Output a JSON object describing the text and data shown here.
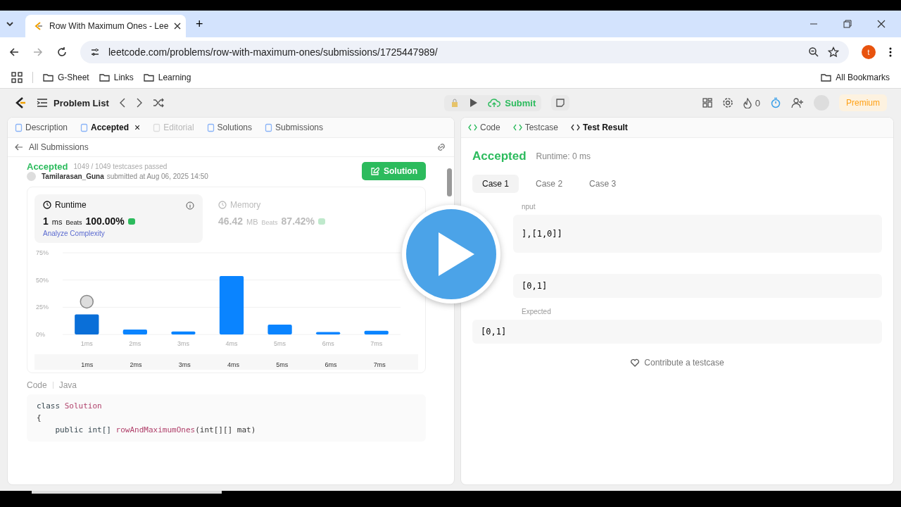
{
  "browser": {
    "tab_title": "Row With Maximum Ones - Lee",
    "new_tab": "+",
    "url": "leetcode.com/problems/row-with-maximum-ones/submissions/1725447989/",
    "profile_initial": "t",
    "bookmarks": [
      {
        "label": "G-Sheet"
      },
      {
        "label": "Links"
      },
      {
        "label": "Learning"
      }
    ],
    "all_bookmarks": "All Bookmarks"
  },
  "header": {
    "problem_list": "Problem List",
    "submit": "Submit",
    "streak": "0",
    "premium": "Premium"
  },
  "left_tabs": [
    {
      "label": "Description",
      "selected": false,
      "disabled": false,
      "closable": false
    },
    {
      "label": "Accepted",
      "selected": true,
      "disabled": false,
      "closable": true
    },
    {
      "label": "Editorial",
      "selected": false,
      "disabled": true,
      "closable": false
    },
    {
      "label": "Solutions",
      "selected": false,
      "disabled": false,
      "closable": false
    },
    {
      "label": "Submissions",
      "selected": false,
      "disabled": false,
      "closable": false
    }
  ],
  "close_mark": "×",
  "all_submissions": "All Submissions",
  "submission": {
    "status": "Accepted",
    "passed": "1049 / 1049 testcases passed",
    "user": "Tamilarasan_Guna",
    "submitted": "submitted at Aug 06, 2025 14:50",
    "solution_button": "Solution"
  },
  "stats": [
    {
      "title": "Runtime",
      "value": "1",
      "unit": "ms",
      "beats_label": "Beats",
      "beats": "100.00%",
      "selected": true,
      "extra": "Analyze Complexity"
    },
    {
      "title": "Memory",
      "value": "46.42",
      "unit": "MB",
      "beats_label": "Beats",
      "beats": "87.42%",
      "selected": false
    }
  ],
  "chart_data": {
    "type": "bar",
    "categories": [
      "1ms",
      "2ms",
      "3ms",
      "4ms",
      "5ms",
      "6ms",
      "7ms"
    ],
    "values": [
      18.5,
      4.5,
      2.8,
      53.7,
      9,
      2.2,
      3.4
    ],
    "ylim": [
      0,
      75
    ],
    "yticks": [
      {
        "value": 0,
        "label": "0%"
      },
      {
        "value": 25,
        "label": "25%"
      },
      {
        "value": 50,
        "label": "50%"
      },
      {
        "value": 75,
        "label": "75%"
      }
    ]
  },
  "navigator_labels": [
    "1ms",
    "2ms",
    "3ms",
    "4ms",
    "5ms",
    "6ms",
    "7ms"
  ],
  "code": {
    "label": "Code",
    "language": "Java",
    "lines": [
      [
        {
          "t": "class ",
          "kind": "keyword"
        },
        {
          "t": "Solution",
          "kind": "name"
        }
      ],
      [
        {
          "t": "{",
          "kind": "plain"
        }
      ],
      [
        {
          "t": "    public int[] ",
          "kind": "keyword"
        },
        {
          "t": "rowAndMaximumOnes",
          "kind": "name"
        },
        {
          "t": "(int[][] mat)",
          "kind": "plain"
        }
      ]
    ]
  },
  "right_tabs": [
    {
      "label": "Code",
      "selected": false
    },
    {
      "label": "Testcase",
      "selected": false
    },
    {
      "label": "Test Result",
      "selected": true
    }
  ],
  "result": {
    "status": "Accepted",
    "runtime": "Runtime: 0 ms",
    "cases": [
      {
        "label": "Case 1",
        "selected": true
      },
      {
        "label": "Case 2",
        "selected": false
      },
      {
        "label": "Case 3",
        "selected": false
      }
    ],
    "input_label": "nput",
    "input_value": "],[1,0]]",
    "output_value": "[0,1]",
    "expected_label": "Expected",
    "expected_value": "[0,1]",
    "contribute": "Contribute a testcase"
  }
}
